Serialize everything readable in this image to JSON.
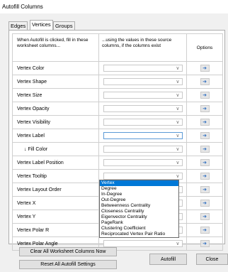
{
  "window": {
    "title": "Autofill Columns"
  },
  "tabs": [
    {
      "label": "Edges"
    },
    {
      "label": "Vertices"
    },
    {
      "label": "Groups"
    }
  ],
  "grid": {
    "header_col1": "When Autofill is clicked, fill in these worksheet columns...",
    "header_col2": "...using the values in these source columns, if the columns exist",
    "header_col3": "Options",
    "rows": [
      {
        "label": "Vertex Color"
      },
      {
        "label": "Vertex Shape"
      },
      {
        "label": "Vertex Size"
      },
      {
        "label": "Vertex Opacity"
      },
      {
        "label": "Vertex Visibility"
      },
      {
        "label": "Vertex Label"
      },
      {
        "label": "↓ Fill Color"
      },
      {
        "label": "Vertex Label Position"
      },
      {
        "label": "Vertex Tooltip"
      },
      {
        "label": "Vertex Layout Order"
      },
      {
        "label": "Vertex X"
      },
      {
        "label": "Vertex Y"
      },
      {
        "label": "Vertex Polar R"
      },
      {
        "label": "Vertex Polar Angle"
      }
    ]
  },
  "dropdown": {
    "items": [
      "Vertex",
      "Degree",
      "In-Degree",
      "Out-Degree",
      "Betweenness Centrality",
      "Closeness Centrality",
      "Eigenvector Centrality",
      "PageRank",
      "Clustering Coefficient",
      "Reciprocated Vertex Pair Ratio"
    ]
  },
  "buttons": {
    "clear_all": "Clear All Worksheet Columns Now",
    "reset_all": "Reset All Autofill Settings",
    "autofill": "Autofill",
    "close": "Close"
  },
  "icons": {
    "options_button": "arrow-right-icon",
    "combo_arrow": "chevron-down-icon"
  },
  "colors": {
    "selection": "#0078d7",
    "options_arrow": "#2f6fc0"
  }
}
